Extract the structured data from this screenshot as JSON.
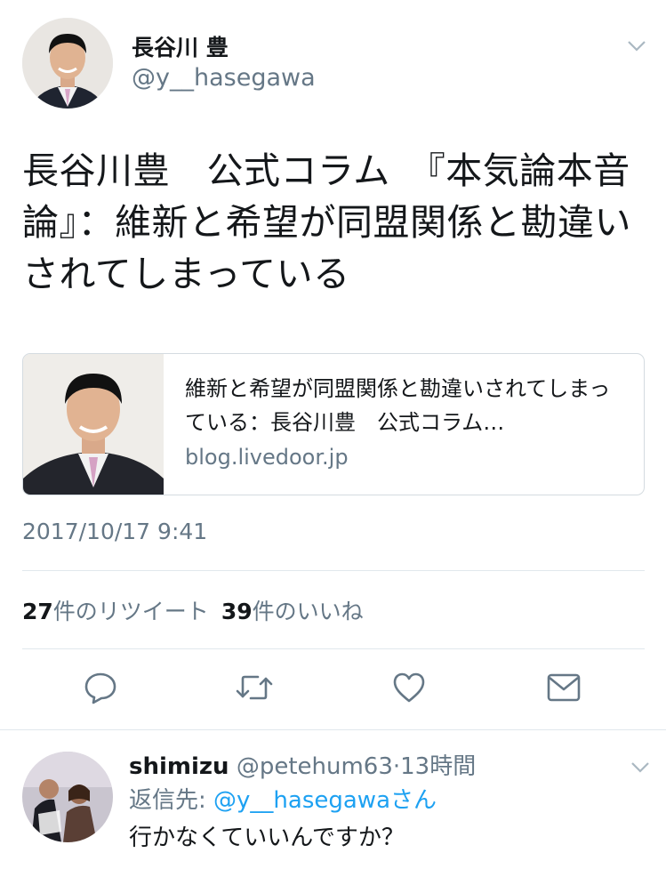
{
  "tweet": {
    "author_name": "長谷川 豊",
    "author_handle": "@y__hasegawa",
    "text": "長谷川豊　公式コラム　『本気論本音論』：維新と希望が同盟関係と勘違いされてしまっている",
    "timestamp": "2017/10/17 9:41",
    "card": {
      "title": "維新と希望が同盟関係と勘違いされてしまっている：長谷川豊　公式コラム…",
      "domain": "blog.livedoor.jp"
    },
    "stats": {
      "retweet_count": "27",
      "retweet_label": "件のリツイート",
      "like_count": "39",
      "like_label": "件のいいね"
    },
    "actions": [
      "reply-icon",
      "retweet-icon",
      "like-icon",
      "direct-message-icon"
    ]
  },
  "reply": {
    "name": "shimizu",
    "handle": "@petehum63",
    "separator": "·",
    "time": "13時間",
    "reply_to_prefix": "返信先: ",
    "reply_to_mention": "@y__hasegawa",
    "reply_to_suffix": "さん",
    "text": "行かなくていいんですか？"
  },
  "colors": {
    "text": "#14171a",
    "secondary": "#657786",
    "link": "#1da1f2",
    "border": "#e1e8ed"
  }
}
